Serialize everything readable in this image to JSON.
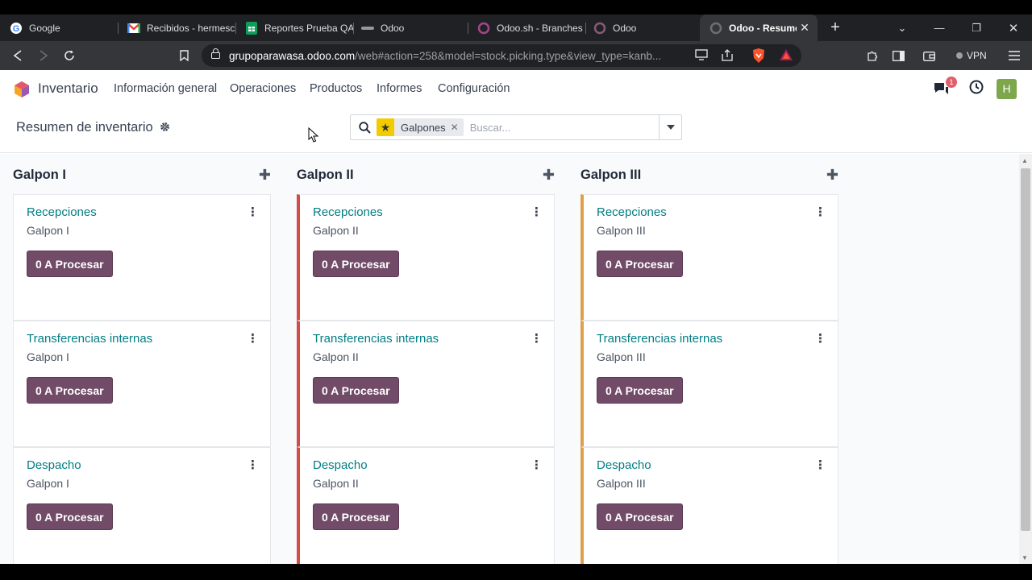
{
  "browser": {
    "tabs": [
      {
        "title": "Google",
        "icon": "google-icon"
      },
      {
        "title": "Recibidos - hermesc",
        "icon": "gmail-icon"
      },
      {
        "title": "Reportes Prueba QA",
        "icon": "sheets-icon"
      },
      {
        "title": "Odoo",
        "icon": "odoo-runbot-icon"
      },
      {
        "title": "Odoo.sh - Branches",
        "icon": "odoo-sh-icon"
      },
      {
        "title": "Odoo",
        "icon": "odoo-icon"
      },
      {
        "title": "Odoo - Resumen",
        "icon": "odoo-icon"
      }
    ],
    "url_host": "grupoparawasa.odoo.com",
    "url_path": "/web#action=258&model=stock.picking.type&view_type=kanb...",
    "vpn_label": "VPN"
  },
  "app": {
    "name": "Inventario",
    "menu": [
      "Información general",
      "Operaciones",
      "Productos",
      "Informes",
      "Configuración"
    ],
    "chat_badge": "1",
    "user_initial": "H"
  },
  "control": {
    "breadcrumb": "Resumen de inventario",
    "facet_label": "Galpones",
    "search_placeholder": "Buscar..."
  },
  "columns": [
    {
      "title": "Galpon I",
      "accent": "none",
      "cards": [
        {
          "title": "Recepciones",
          "sub": "Galpon I",
          "button": "0 A Procesar"
        },
        {
          "title": "Transferencias internas",
          "sub": "Galpon I",
          "button": "0 A Procesar"
        },
        {
          "title": "Despacho",
          "sub": "Galpon I",
          "button": "0 A Procesar"
        }
      ]
    },
    {
      "title": "Galpon II",
      "accent": "#d44c46",
      "cards": [
        {
          "title": "Recepciones",
          "sub": "Galpon II",
          "button": "0 A Procesar"
        },
        {
          "title": "Transferencias internas",
          "sub": "Galpon II",
          "button": "0 A Procesar"
        },
        {
          "title": "Despacho",
          "sub": "Galpon II",
          "button": "0 A Procesar"
        }
      ]
    },
    {
      "title": "Galpon III",
      "accent": "#e0a04b",
      "cards": [
        {
          "title": "Recepciones",
          "sub": "Galpon III",
          "button": "0 A Procesar"
        },
        {
          "title": "Transferencias internas",
          "sub": "Galpon III",
          "button": "0 A Procesar"
        },
        {
          "title": "Despacho",
          "sub": "Galpon III",
          "button": "0 A Procesar"
        }
      ]
    }
  ],
  "colors": {
    "primary": "#714b67",
    "link": "#017e84",
    "badge": "#e35e6b",
    "avatar": "#7ea64b"
  }
}
